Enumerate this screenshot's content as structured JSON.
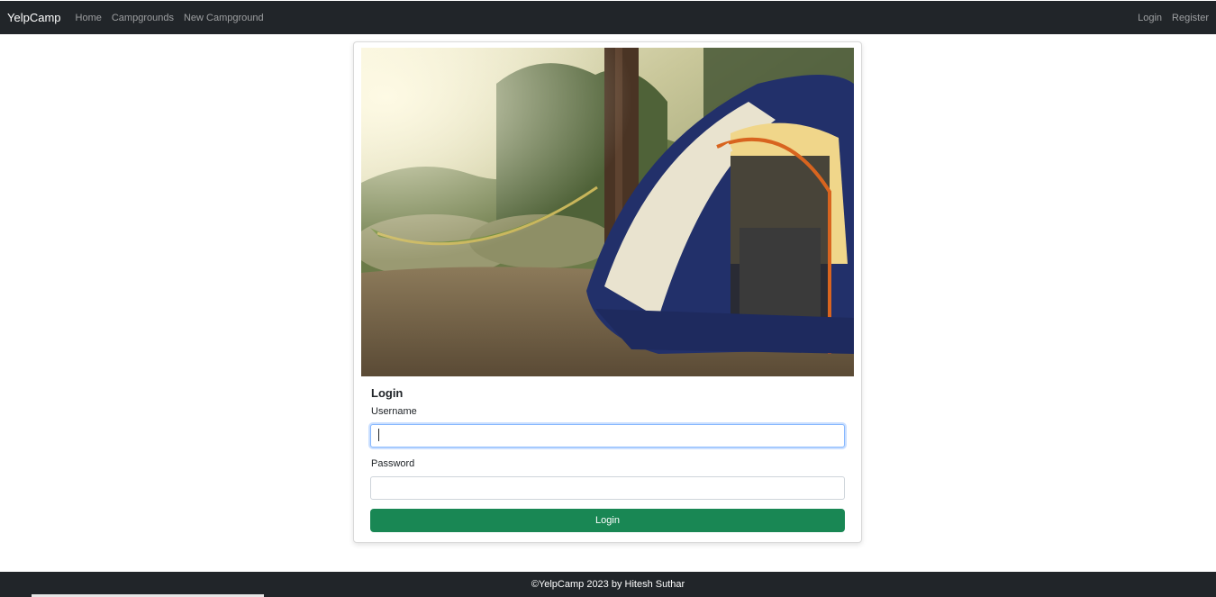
{
  "navbar": {
    "brand": "YelpCamp",
    "links": [
      "Home",
      "Campgrounds",
      "New Campground"
    ],
    "right_links": [
      "Login",
      "Register"
    ]
  },
  "hero_image": {
    "alt": "camping tent and hammock in forest"
  },
  "form": {
    "title": "Login",
    "username_label": "Username",
    "username_value": "",
    "password_label": "Password",
    "password_value": "",
    "submit_label": "Login"
  },
  "footer": {
    "text": "©YelpCamp 2023 by Hitesh Suthar"
  },
  "colors": {
    "navbar_bg": "#212529",
    "primary_button": "#198754",
    "focus_border": "#86b7fe"
  }
}
